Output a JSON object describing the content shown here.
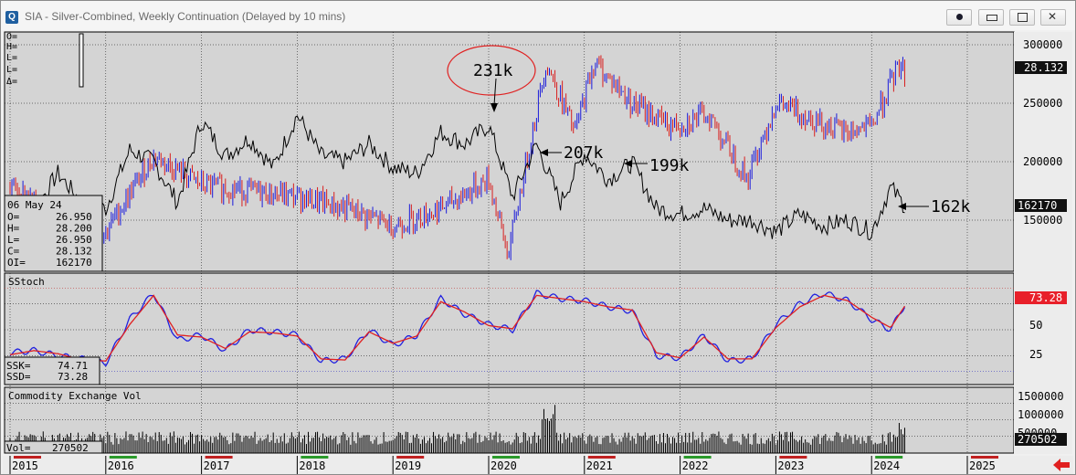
{
  "window": {
    "title": "SIA - Silver-Combined, Weekly Continuation (Delayed by 10 mins)",
    "icon": "chart-app-icon",
    "buttons": [
      "record-icon",
      "minimize-icon",
      "restore-icon",
      "close-icon"
    ]
  },
  "colors": {
    "up": "#1a1adb",
    "down": "#d81e1e",
    "oi": "#000000",
    "ssk": "#2020e0",
    "ssd": "#e02020",
    "panel_bg": "#d4d4d4",
    "red_label": "#e8202a"
  },
  "readout": {
    "o": "O=",
    "h": "H=",
    "l1": "L=",
    "l2": "L=",
    "d": "Δ="
  },
  "info_box": {
    "date": "06 May 24",
    "lines": [
      [
        "O=",
        "26.950"
      ],
      [
        "H=",
        "28.200"
      ],
      [
        "L=",
        "26.950"
      ],
      [
        "C=",
        "28.132"
      ],
      [
        "OI=",
        "162170"
      ]
    ]
  },
  "price_axis": {
    "ticks": [
      "300000",
      "250000",
      "200000",
      "150000"
    ],
    "last_price": "28.132",
    "last_oi": "162170"
  },
  "annotations": [
    "231k",
    "207k",
    "199k",
    "162k"
  ],
  "stoch": {
    "title": "SStoch",
    "ticks": [
      "50",
      "25"
    ],
    "value_badge": "73.28",
    "ssk_label": "SSK=",
    "ssk_value": "74.71",
    "ssd_label": "SSD=",
    "ssd_value": "73.28"
  },
  "volume": {
    "title": "Commodity Exchange Vol",
    "ticks": [
      "1500000",
      "1000000",
      "500000"
    ],
    "value_badge": "270502",
    "vol_label": "Vol=",
    "vol_value": "270502"
  },
  "time_axis": [
    "2015",
    "2016",
    "2017",
    "2018",
    "2019",
    "2020",
    "2021",
    "2022",
    "2023",
    "2024",
    "2025"
  ],
  "chart_data": {
    "type": "line",
    "x": [
      2015.0,
      2015.25,
      2015.5,
      2015.75,
      2016.0,
      2016.25,
      2016.5,
      2016.75,
      2017.0,
      2017.25,
      2017.5,
      2017.75,
      2018.0,
      2018.25,
      2018.5,
      2018.75,
      2019.0,
      2019.25,
      2019.5,
      2019.75,
      2020.0,
      2020.25,
      2020.5,
      2020.75,
      2021.0,
      2021.25,
      2021.5,
      2021.75,
      2022.0,
      2022.25,
      2022.5,
      2022.75,
      2023.0,
      2023.25,
      2023.5,
      2023.75,
      2024.0,
      2024.2,
      2024.35
    ],
    "series": [
      {
        "name": "OI",
        "values": [
          170000,
          158000,
          190000,
          165000,
          160000,
          210000,
          200000,
          165000,
          235000,
          205000,
          220000,
          195000,
          240000,
          205000,
          200000,
          215000,
          195000,
          190000,
          225000,
          215000,
          231000,
          170000,
          215000,
          165000,
          207000,
          185000,
          199000,
          160000,
          155000,
          160000,
          150000,
          150000,
          140000,
          155000,
          145000,
          150000,
          140000,
          178000,
          162000
        ]
      },
      {
        "name": "SSK",
        "values": [
          28,
          30,
          25,
          22,
          18,
          60,
          85,
          40,
          45,
          30,
          50,
          48,
          45,
          20,
          22,
          50,
          35,
          45,
          80,
          65,
          55,
          50,
          85,
          80,
          78,
          72,
          68,
          25,
          23,
          45,
          20,
          22,
          55,
          75,
          85,
          78,
          60,
          50,
          74.71
        ]
      },
      {
        "name": "SSD",
        "values": [
          26,
          30,
          27,
          21,
          20,
          55,
          83,
          45,
          43,
          32,
          48,
          47,
          44,
          22,
          21,
          48,
          37,
          44,
          77,
          67,
          54,
          51,
          83,
          80,
          77,
          72,
          69,
          28,
          23,
          43,
          22,
          22,
          52,
          72,
          83,
          78,
          62,
          52,
          73.28
        ]
      }
    ],
    "ylim": [
      100000,
      310000
    ],
    "yticks": [
      150000,
      200000,
      250000,
      300000
    ],
    "stoch_ylim": [
      0,
      100
    ],
    "stoch_ticks": [
      25,
      50,
      75
    ],
    "volume_ylim": [
      0,
      1700000
    ],
    "volume_ticks": [
      500000,
      1000000,
      1500000
    ],
    "volume_last": 270502,
    "grid": true
  }
}
